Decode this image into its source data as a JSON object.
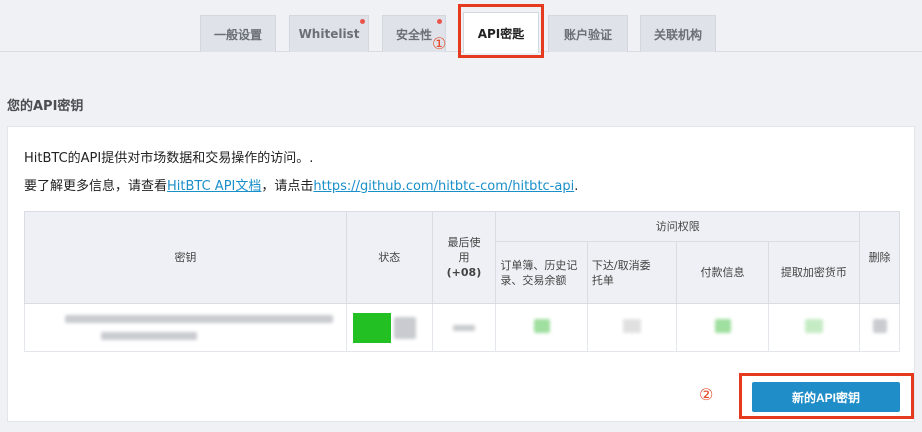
{
  "tabs": [
    {
      "label": "一般设置",
      "dot": false
    },
    {
      "label": "Whitelist",
      "dot": true
    },
    {
      "label": "安全性",
      "dot": true
    },
    {
      "label": "API密匙",
      "dot": false,
      "active": true
    },
    {
      "label": "账户验证",
      "dot": false
    },
    {
      "label": "关联机构",
      "dot": false
    }
  ],
  "annotations": {
    "marker1": "①",
    "marker2": "②"
  },
  "section_title": "您的API密钥",
  "description": {
    "line1": "HitBTC的API提供对市场数据和交易操作的访问。.",
    "line2_prefix": "要了解更多信息，请查看",
    "docs_link": "HitBTC API文档",
    "line2_middle": "，请点击",
    "github_link": "https://github.com/hitbtc-com/hitbtc-api",
    "line2_suffix": "."
  },
  "table": {
    "col_key": "密钥",
    "col_status": "状态",
    "col_last_used_1": "最后使",
    "col_last_used_2": "用",
    "col_last_used_3": "(+08)",
    "col_access": "访问权限",
    "col_orderbook_1": "订单簿、历史记",
    "col_orderbook_2": "录、交易余额",
    "col_place_cancel_1": "下达/取消委",
    "col_place_cancel_2": "托单",
    "col_payment": "付款信息",
    "col_withdraw": "提取加密货币",
    "col_delete": "删除"
  },
  "new_key_button": "新的API密钥",
  "colors": {
    "accent": "#1f8ec8",
    "annotation": "#e53a1e",
    "status_active": "#22c022"
  }
}
